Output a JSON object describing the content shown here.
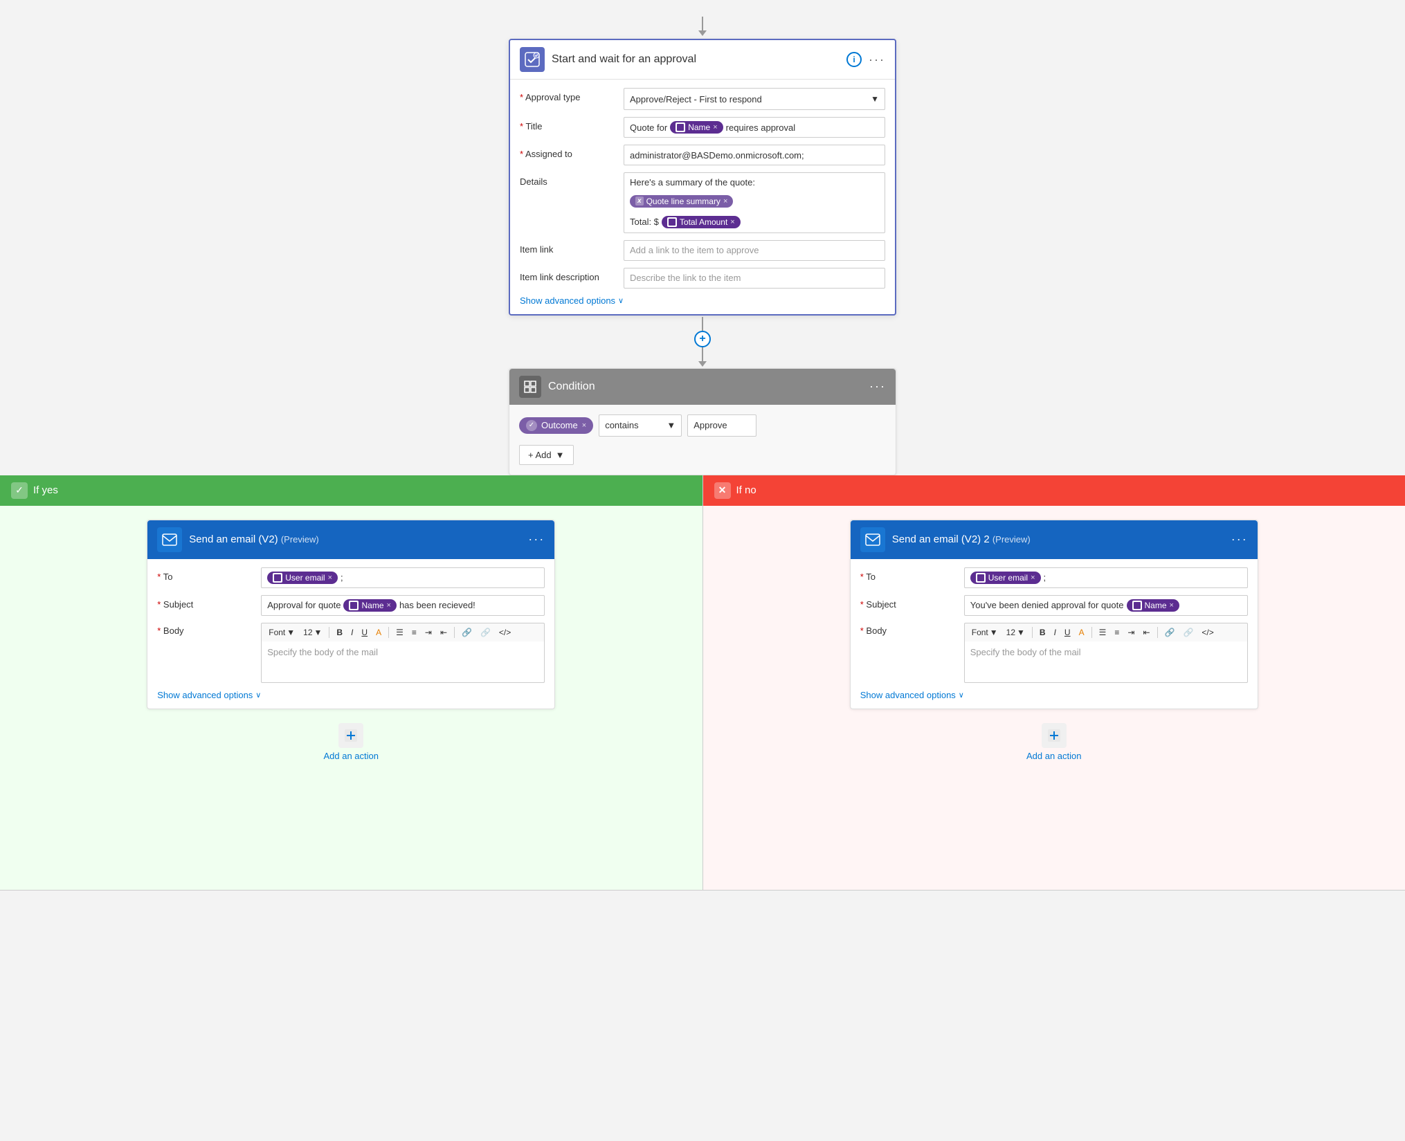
{
  "approval": {
    "header": {
      "title": "Start and wait for an approval",
      "icon": "approval-icon"
    },
    "fields": {
      "approval_type_label": "Approval type",
      "approval_type_value": "Approve/Reject - First to respond",
      "title_label": "Title",
      "title_prefix": "Quote for",
      "title_token": "Name",
      "title_suffix": "requires approval",
      "assigned_to_label": "Assigned to",
      "assigned_to_value": "administrator@BASDemo.onmicrosoft.com;",
      "details_label": "Details",
      "details_text": "Here's a summary of the quote:",
      "details_token": "Quote line summary",
      "details_total_prefix": "Total: $",
      "details_total_token": "Total Amount",
      "item_link_label": "Item link",
      "item_link_placeholder": "Add a link to the item to approve",
      "item_link_desc_label": "Item link description",
      "item_link_desc_placeholder": "Describe the link to the item",
      "show_advanced": "Show advanced options"
    }
  },
  "condition": {
    "title": "Condition",
    "token": "Outcome",
    "operator": "contains",
    "value": "Approve",
    "add_label": "+ Add"
  },
  "branch_yes": {
    "label": "If yes",
    "email": {
      "title": "Send an email (V2)",
      "preview": "(Preview)",
      "to_label": "To",
      "to_token": "User email",
      "subject_label": "Subject",
      "subject_prefix": "Approval for quote",
      "subject_token": "Name",
      "subject_suffix": "has been recieved!",
      "body_label": "Body",
      "font_label": "Font",
      "font_size": "12",
      "body_placeholder": "Specify the body of the mail",
      "show_advanced": "Show advanced options"
    },
    "add_action": "Add an action"
  },
  "branch_no": {
    "label": "If no",
    "email": {
      "title": "Send an email (V2) 2",
      "preview": "(Preview)",
      "to_label": "To",
      "to_token": "User email",
      "subject_label": "Subject",
      "subject_prefix": "You've been denied approval for quote",
      "subject_token": "Name",
      "body_label": "Body",
      "font_label": "Font",
      "font_size": "12",
      "body_placeholder": "Specify the body of the mail",
      "show_advanced": "Show advanced options"
    },
    "add_action": "Add an action"
  },
  "icons": {
    "checkmark": "✓",
    "close": "✕",
    "dots": "···",
    "plus": "+",
    "arrow_down": "▼",
    "chevron_down": "∨",
    "info": "i",
    "approval_symbol": "✓",
    "condition_symbol": "⊞",
    "email_symbol": "✉"
  }
}
